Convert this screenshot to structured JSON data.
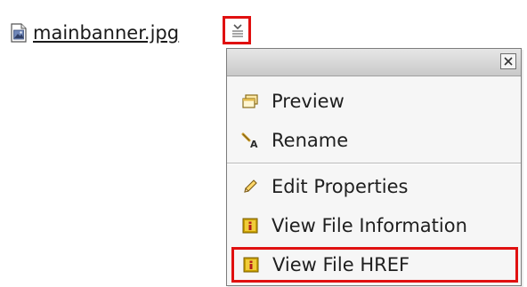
{
  "file": {
    "name": "mainbanner.jpg",
    "icon": "image-file-icon"
  },
  "menu_trigger": {
    "icon": "menu-dropdown-icon"
  },
  "context_menu": {
    "close_icon": "close-icon",
    "items": [
      {
        "label": "Preview",
        "icon": "preview-window-icon"
      },
      {
        "label": "Rename",
        "icon": "rename-icon"
      },
      {
        "label": "Edit Properties",
        "icon": "pencil-icon"
      },
      {
        "label": "View File Information",
        "icon": "info-icon"
      },
      {
        "label": "View File HREF",
        "icon": "info-icon"
      }
    ]
  },
  "colors": {
    "highlight": "#e01010",
    "menu_background": "#f6f6f6",
    "info_icon_fill": "#c8a000"
  }
}
